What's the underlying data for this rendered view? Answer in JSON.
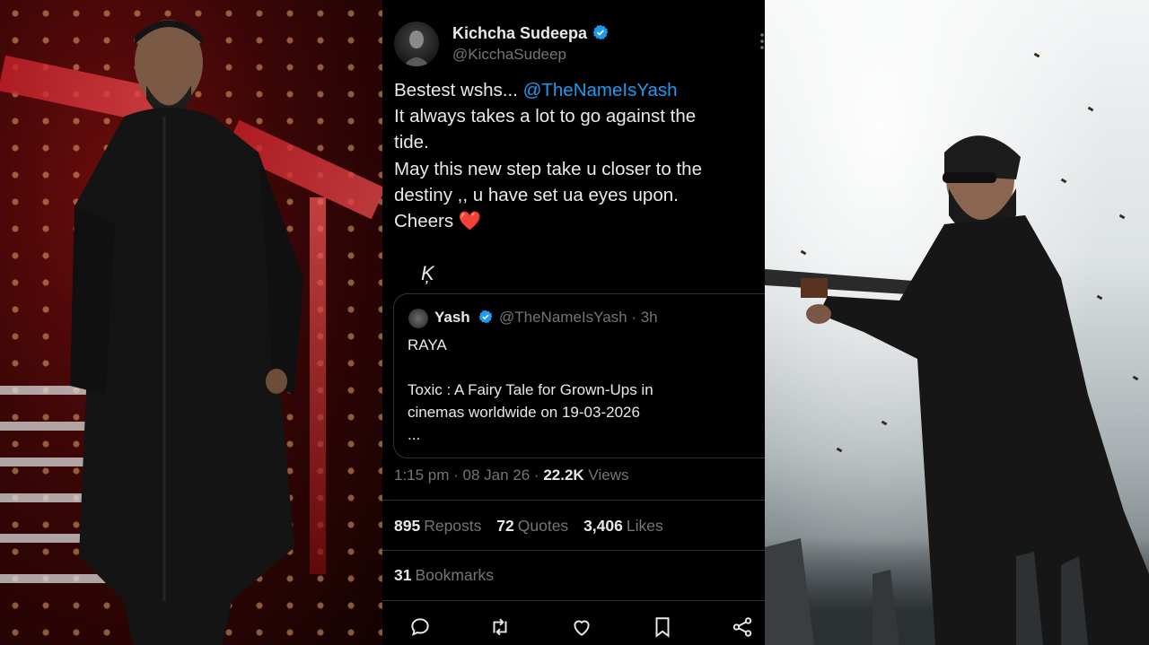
{
  "tweet": {
    "author": {
      "name": "Kichcha Sudeepa",
      "handle": "@KicchaSudeep"
    },
    "body": {
      "line1_text": "Bestest wshs... ",
      "line1_mention": "@TheNameIsYash",
      "line2": "It always takes a lot to go against the",
      "line3": "tide.",
      "line4": "May this new step take u closer to the",
      "line5": "destiny ,, u have set ua eyes upon.",
      "line6_text": "Cheers ",
      "line6_emoji": "❤️"
    },
    "signature": "Ķ",
    "quoted": {
      "name": "Yash",
      "handle_time": "@TheNameIsYash · 3h",
      "line1": "RAYA",
      "line2": "Toxic : A Fairy Tale for Grown-Ups in",
      "line3": "cinemas worldwide on 19-03-2026",
      "line4": "..."
    },
    "meta": {
      "time_date": "1:15 pm · 08 Jan 26 · ",
      "views_count": "22.2K",
      "views_label": " Views"
    },
    "stats": {
      "reposts_count": "895",
      "reposts_label": "Reposts",
      "quotes_count": "72",
      "quotes_label": "Quotes",
      "likes_count": "3,406",
      "likes_label": "Likes",
      "bookmarks_count": "31",
      "bookmarks_label": "Bookmarks"
    },
    "actions": [
      "reply-icon",
      "repost-icon",
      "like-icon",
      "bookmark-icon",
      "share-icon"
    ]
  },
  "colors": {
    "background": "#000000",
    "text_primary": "#e7e9ea",
    "text_secondary": "#71767b",
    "link": "#1d9bf0",
    "verified": "#1d9bf0",
    "divider": "#2f3336",
    "heart": "#f91880"
  }
}
